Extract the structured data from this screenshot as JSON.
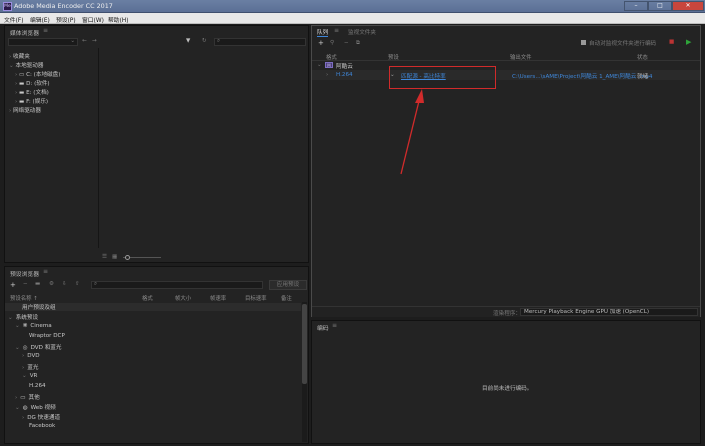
{
  "window": {
    "title": "Adobe Media Encoder CC 2017",
    "app_icon_letters": "Me",
    "controls": [
      "–",
      "□",
      "✕"
    ]
  },
  "menu": [
    "文件(F)",
    "编辑(E)",
    "预设(P)",
    "窗口(W)",
    "帮助(H)"
  ],
  "media_browser": {
    "title": "媒体浏览器",
    "tree": {
      "favorites": "收藏夹",
      "local_drives": "本地驱动器",
      "drives": [
        "C: (本地磁盘)",
        "D: (软件)",
        "E: (文档)",
        "F: (娱乐)"
      ],
      "network_drives": "网络驱动器"
    }
  },
  "queue": {
    "tabs": [
      "队列",
      "监视文件夹"
    ],
    "auto_start_label": "自动对监视文件夹进行编码",
    "columns": {
      "format": "格式",
      "preset": "预设",
      "output": "输出文件",
      "status": "状态"
    },
    "group_name": "阿酷云",
    "row": {
      "format": "H.264",
      "preset": "匹配源 - 高比特率",
      "output": "C:\\Users...\\sAME\\Project\\阿酷云 1_AME\\阿酷云 .mp4",
      "status": "就绪"
    },
    "renderer_label": "渲染程序：",
    "renderer_value": "Mercury Playback Engine GPU 加速 (OpenCL)"
  },
  "encoding": {
    "title": "编码",
    "empty_message": "目前尚未进行编码。"
  },
  "preset_browser": {
    "title": "预设浏览器",
    "apply_button": "应用预设",
    "columns": [
      "预设名称 ↑",
      "格式",
      "帧大小",
      "帧速率",
      "目标速率",
      "备注"
    ],
    "items": [
      {
        "label": "用户预设及组",
        "indent": 1
      },
      {
        "label": "系统预设",
        "indent": 1,
        "expander": "⌄"
      },
      {
        "label": "Cinema",
        "indent": 2,
        "expander": "⌄",
        "icon": "❋"
      },
      {
        "label": "Wraptor DCP",
        "indent": 3
      },
      {
        "label": "DVD 和蓝光",
        "indent": 2,
        "expander": "⌄",
        "icon": "◎"
      },
      {
        "label": "DVD",
        "indent": 3,
        "expander": "›"
      },
      {
        "label": "蓝光",
        "indent": 3,
        "expander": "›"
      },
      {
        "label": "VR",
        "indent": 3,
        "expander": "⌄"
      },
      {
        "label": "H.264",
        "indent": 3
      },
      {
        "label": "其他",
        "indent": 2,
        "expander": "›",
        "icon": "▭"
      },
      {
        "label": "Web 视频",
        "indent": 2,
        "expander": "⌄",
        "icon": "◍"
      },
      {
        "label": "DG 快速通道",
        "indent": 3,
        "expander": "›"
      },
      {
        "label": "Facebook",
        "indent": 3
      }
    ]
  },
  "colors": {
    "link": "#3f87d9",
    "highlight": "#d12b2b",
    "accent_orange": "#e58a2b"
  }
}
